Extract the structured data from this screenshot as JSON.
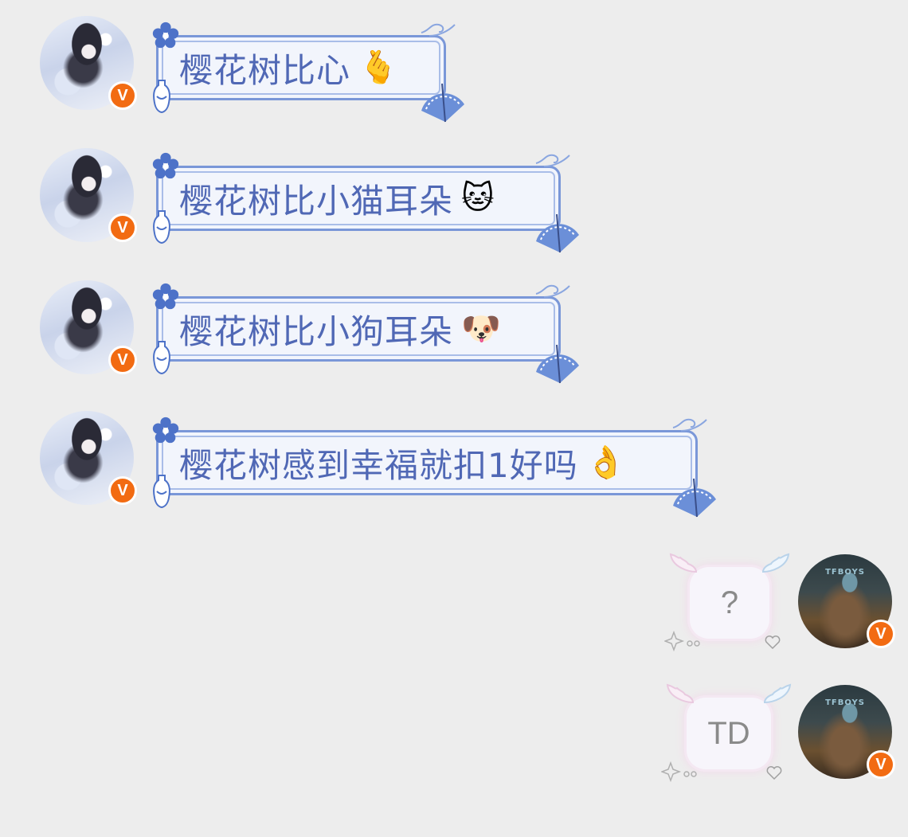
{
  "messages": [
    {
      "side": "left",
      "text": "樱花树比心",
      "emoji": "🫰"
    },
    {
      "side": "left",
      "text": "樱花树比小猫耳朵",
      "emoji": "🐱"
    },
    {
      "side": "left",
      "text": "樱花树比小狗耳朵",
      "emoji": "🐶"
    },
    {
      "side": "left",
      "text": "樱花树感到幸福就扣1好吗",
      "emoji": "👌"
    },
    {
      "side": "right",
      "text": "?"
    },
    {
      "side": "right",
      "text": "TD"
    }
  ],
  "avatars": {
    "other_logo": "TFBOYS",
    "badge": "V"
  },
  "colors": {
    "background": "#ededed",
    "bubble_text": "#5068b5",
    "bubble_border": "#7a97d8",
    "badge": "#f26b12"
  }
}
